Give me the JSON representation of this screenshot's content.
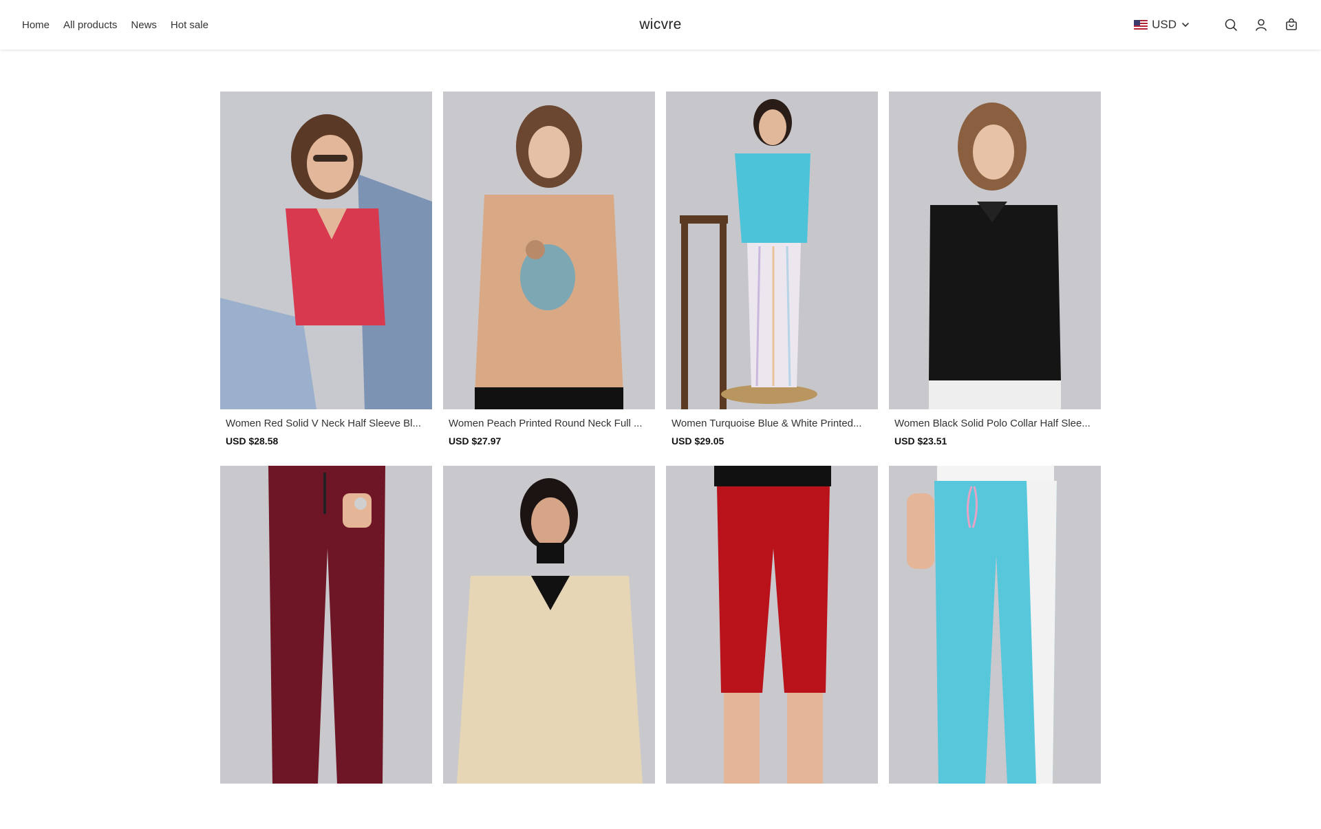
{
  "header": {
    "nav": [
      "Home",
      "All products",
      "News",
      "Hot sale"
    ],
    "brand": "wicvre",
    "currency": {
      "label": "USD",
      "flag": "us-flag-icon"
    },
    "icons": [
      "search-icon",
      "user-icon",
      "cart-icon"
    ]
  },
  "products": [
    {
      "title": "Women Red Solid V Neck Half Sleeve Bl...",
      "price": "USD $28.58"
    },
    {
      "title": "Women Peach Printed Round Neck Full ...",
      "price": "USD $27.97"
    },
    {
      "title": "Women Turquoise Blue & White Printed...",
      "price": "USD $29.05"
    },
    {
      "title": "Women Black Solid Polo Collar Half Slee...",
      "price": "USD $23.51"
    },
    {
      "title": "",
      "price": ""
    },
    {
      "title": "",
      "price": ""
    },
    {
      "title": "",
      "price": ""
    },
    {
      "title": "",
      "price": ""
    }
  ],
  "colors": {
    "photo_bg": "#c9c9cd",
    "text": "#333333",
    "price": "#111111"
  }
}
